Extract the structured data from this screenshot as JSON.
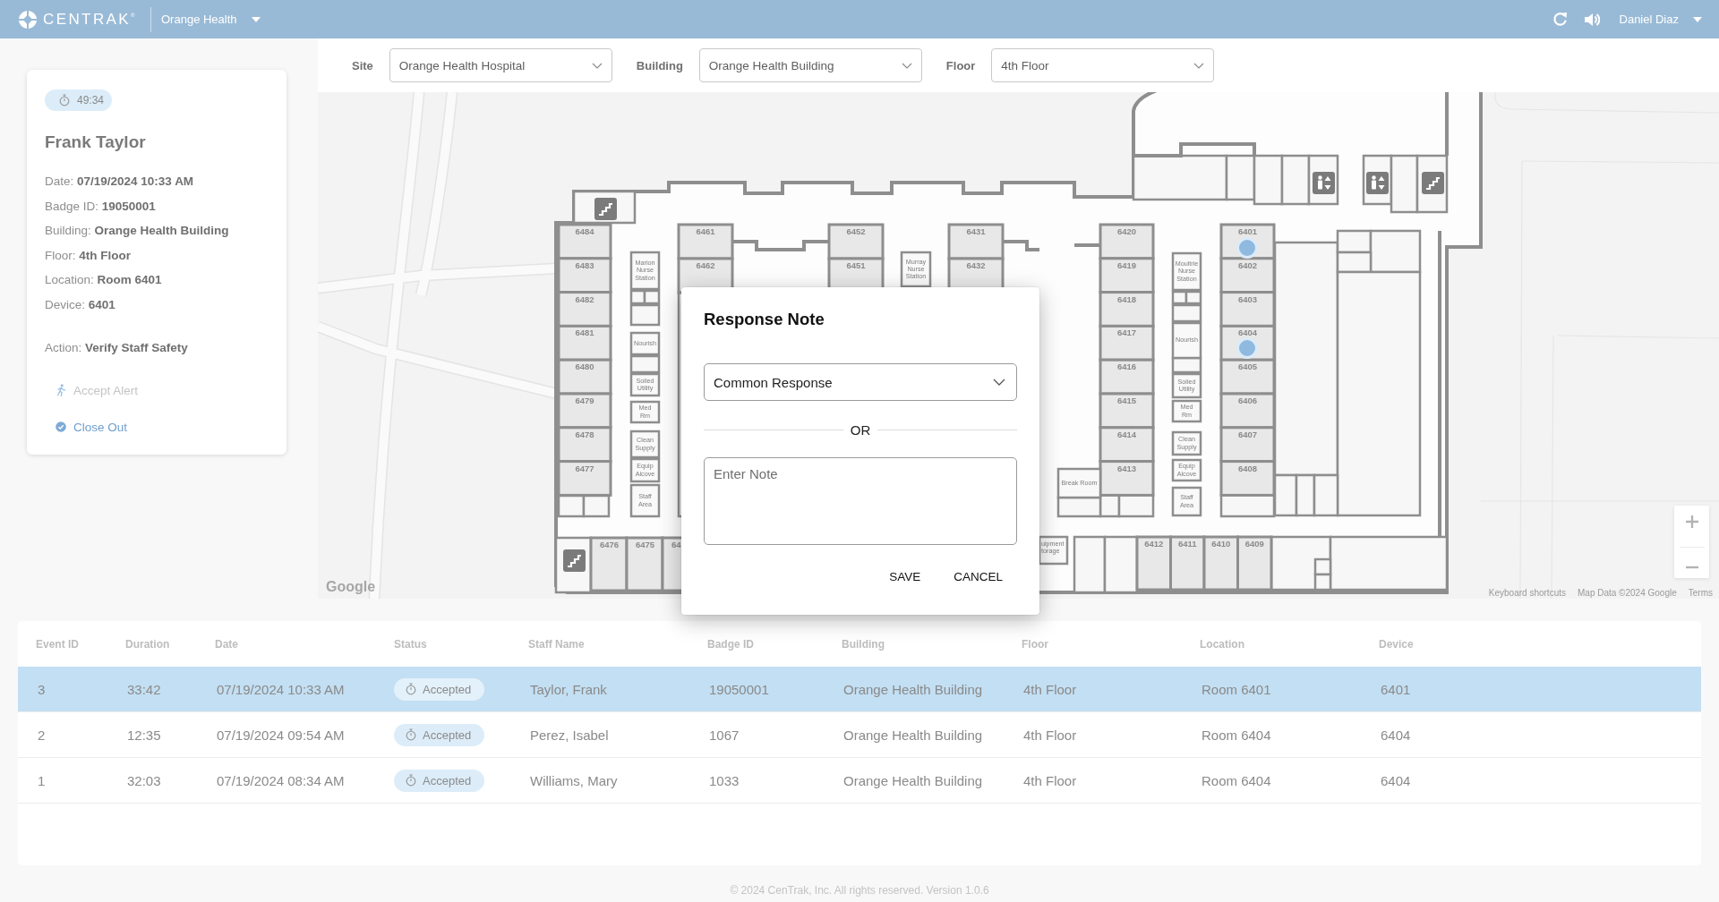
{
  "top_bar": {
    "logo": "CENTRAK$^{®}$",
    "organization": "Orange Health",
    "user": "Daniel Diaz"
  },
  "filters": [
    {
      "label": "Site",
      "value": "Orange Health Hospital"
    },
    {
      "label": "Building",
      "value": "Orange Health Building"
    },
    {
      "label": "Floor",
      "value": "4th Floor"
    }
  ],
  "alert_card": {
    "timer": "49:34",
    "name": "Frank Taylor",
    "details": [
      "Date: **07/19/2024 10:33 AM**",
      "Badge ID: **19050001**",
      "Building: **Orange Health Building**",
      "Floor: **4th Floor**",
      "Location: **Room 6401**",
      "Device: **6401**"
    ],
    "action": "Action: **Verify Staff Safety**",
    "buttons": [
      {
        "label": "Accept Alert",
        "kind": "accept",
        "disabled": true
      },
      {
        "label": "Close Out",
        "kind": "close",
        "disabled": false
      }
    ]
  },
  "map": {
    "floor_plan": {
      "room_groups": [
        {
          "rooms": [
            "6484",
            "6483",
            "6482",
            "6481",
            "6480",
            "6479",
            "6478",
            "6477"
          ]
        },
        {
          "rooms": [
            "6461",
            "6462"
          ]
        },
        {
          "rooms": [
            "6452",
            "6451"
          ]
        },
        {
          "rooms": [
            "6431",
            "6432"
          ]
        },
        {
          "rooms": [
            "6420",
            "6419",
            "6418",
            "6417",
            "6416",
            "6415",
            "6414",
            "6413"
          ]
        },
        {
          "rooms": [
            "6401",
            "6402",
            "6403",
            "6404",
            "6405",
            "6406",
            "6407",
            "6408"
          ]
        },
        {
          "rooms": [
            "6476",
            "6475",
            "64"
          ]
        },
        {
          "rooms": [
            "6412",
            "6411",
            "6410",
            "6409"
          ]
        }
      ],
      "spaces": [
        "Marion Nurse Station",
        "Nourish",
        "Soiled Utility",
        "Med Rm",
        "Clean Supply",
        "Equip Alcove",
        "Staff Area",
        "Murray Nurse Station",
        "Moultrie Nurse Station",
        "Nourish",
        "Soiled Utility",
        "Med Rm",
        "Clean Supply",
        "Equip Alcove",
        "Staff Area",
        "Break Room",
        "uipment torage"
      ]
    },
    "logo": "Google",
    "attribution": [
      "Keyboard shortcuts",
      "Map Data ©2024 Google",
      "Terms"
    ]
  },
  "dialog": {
    "title": "Response Note",
    "select": {
      "value": "Common Response"
    },
    "separator": "OR",
    "note": {
      "placeholder": "Enter Note"
    },
    "buttons": [
      "SAVE",
      "CANCEL"
    ]
  },
  "table": {
    "columns": [
      {
        "label": "Event ID",
        "kind": "text"
      },
      {
        "label": "Duration",
        "kind": "text"
      },
      {
        "label": "Date",
        "kind": "text"
      },
      {
        "label": "Status",
        "kind": "status"
      },
      {
        "label": "Staff Name",
        "kind": "text"
      },
      {
        "label": "Badge ID",
        "kind": "text"
      },
      {
        "label": "Building",
        "kind": "text"
      },
      {
        "label": "Floor",
        "kind": "text"
      },
      {
        "label": "Location",
        "kind": "text"
      },
      {
        "label": "Device",
        "kind": "text"
      }
    ],
    "rows": [
      {
        "selected": true,
        "cells": [
          "3",
          "33:42",
          "07/19/2024 10:33 AM",
          "Accepted",
          "Taylor, Frank",
          "19050001",
          "Orange Health Building",
          "4th Floor",
          "Room 6401",
          "6401"
        ]
      },
      {
        "selected": false,
        "cells": [
          "2",
          "12:35",
          "07/19/2024 09:54 AM",
          "Accepted",
          "Perez, Isabel",
          "1067",
          "Orange Health Building",
          "4th Floor",
          "Room 6404",
          "6404"
        ]
      },
      {
        "selected": false,
        "cells": [
          "1",
          "32:03",
          "07/19/2024 08:34 AM",
          "Accepted",
          "Williams, Mary",
          "1033",
          "Orange Health Building",
          "4th Floor",
          "Room 6404",
          "6404"
        ]
      }
    ]
  },
  "footer": "© 2024 CenTrak, Inc. All rights reserved. Version 1.0.6"
}
